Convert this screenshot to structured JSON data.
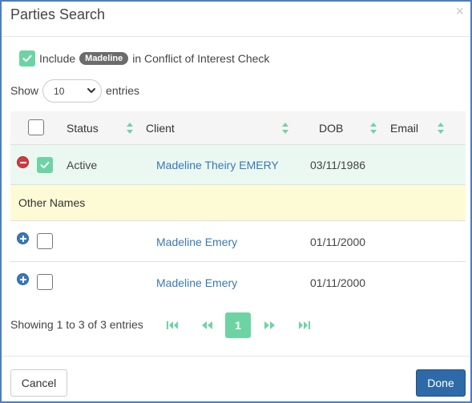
{
  "dialog": {
    "title": "Parties Search",
    "close_symbol": "×"
  },
  "conflict_check": {
    "checked": true,
    "prefix": "Include",
    "party_name": "Madeline",
    "suffix": "in Conflict of Interest Check"
  },
  "length_menu": {
    "show_label": "Show",
    "selected": "10",
    "entries_label": "entries"
  },
  "table": {
    "headers": {
      "status": "Status",
      "client": "Client",
      "dob": "DOB",
      "email": "Email"
    },
    "main_row": {
      "checked": true,
      "status": "Active",
      "client": "Madeline Theiry EMERY",
      "dob": "03/11/1986",
      "email": ""
    },
    "group_label": "Other Names",
    "sub_rows": [
      {
        "client": "Madeline Emery",
        "dob": "01/11/2000",
        "checked": false
      },
      {
        "client": "Madeline Emery",
        "dob": "01/11/2000",
        "checked": false
      }
    ]
  },
  "pagination": {
    "info": "Showing 1 to 3 of 3 entries",
    "current_page": "1",
    "icons": [
      "first-page-icon",
      "previous-page-icon",
      "next-page-icon",
      "last-page-icon"
    ]
  },
  "footer": {
    "cancel_label": "Cancel",
    "done_label": "Done"
  },
  "colors": {
    "accent_green": "#6ed3a3",
    "link_blue": "#3a78b6",
    "primary_button": "#2e6aa8",
    "remove_red": "#d9363e",
    "active_row": "#eaf8f1",
    "group_row": "#fdfbd5"
  }
}
